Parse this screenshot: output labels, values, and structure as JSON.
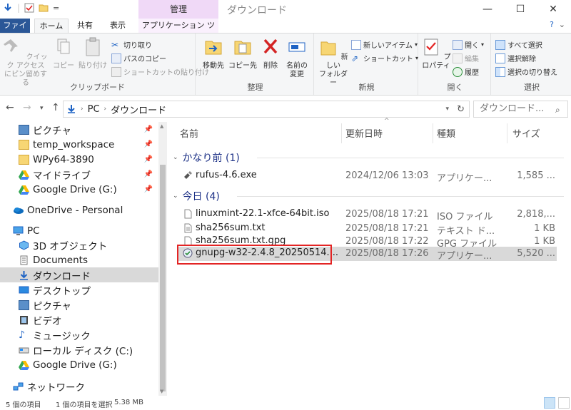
{
  "window": {
    "title": "ダウンロード",
    "manage_label": "管理",
    "qat_dropdown": "="
  },
  "ribbon_tabs": {
    "file": "ファイル",
    "home": "ホーム",
    "share": "共有",
    "view": "表示",
    "app_tools": "アプリケーション ツール"
  },
  "ribbon": {
    "clipboard": {
      "label": "クリップボード",
      "pin": "クイック アクセス\nにピン留めする",
      "copy": "コピー",
      "paste": "貼り付け",
      "cut": "切り取り",
      "copy_path": "パスのコピー",
      "paste_shortcut": "ショートカットの貼り付け"
    },
    "organize": {
      "label": "整理",
      "move_to": "移動先",
      "copy_to": "コピー先",
      "delete": "削除",
      "rename": "名前の\n変更"
    },
    "new": {
      "label": "新規",
      "new_folder": "新しい\nフォルダー",
      "new_item": "新しいアイテム",
      "shortcut": "ショートカット"
    },
    "open": {
      "label": "開く",
      "properties": "プロパティ",
      "open": "開く",
      "edit": "編集",
      "history": "履歴"
    },
    "select": {
      "label": "選択",
      "select_all": "すべて選択",
      "select_none": "選択解除",
      "invert": "選択の切り替え"
    }
  },
  "address": {
    "crumbs": [
      "PC",
      "ダウンロード"
    ],
    "search_placeholder": "ダウンロード..."
  },
  "nav": {
    "items": [
      {
        "label": "ピクチャ",
        "icon": "pictures-icon",
        "pinned": true
      },
      {
        "label": "temp_workspace",
        "icon": "folder-icon",
        "pinned": true
      },
      {
        "label": "WPy64-3890",
        "icon": "folder-icon",
        "pinned": true
      },
      {
        "label": "マイドライブ",
        "icon": "google-drive-icon",
        "pinned": true
      },
      {
        "label": "Google Drive (G:)",
        "icon": "google-drive-icon",
        "pinned": true
      },
      {
        "label": "OneDrive - Personal",
        "icon": "onedrive-icon",
        "pinned": false
      },
      {
        "label": "PC",
        "icon": "pc-icon",
        "pinned": false
      },
      {
        "label": "3D オブジェクト",
        "icon": "3d-objects-icon",
        "pinned": false
      },
      {
        "label": "Documents",
        "icon": "documents-icon",
        "pinned": false
      },
      {
        "label": "ダウンロード",
        "icon": "download-arrow-icon",
        "pinned": false
      },
      {
        "label": "デスクトップ",
        "icon": "desktop-icon",
        "pinned": false
      },
      {
        "label": "ピクチャ",
        "icon": "pictures-icon",
        "pinned": false
      },
      {
        "label": "ビデオ",
        "icon": "video-icon",
        "pinned": false
      },
      {
        "label": "ミュージック",
        "icon": "music-icon",
        "pinned": false
      },
      {
        "label": "ローカル ディスク (C:)",
        "icon": "drive-icon",
        "pinned": false
      },
      {
        "label": "Google Drive (G:)",
        "icon": "google-drive-icon",
        "pinned": false
      },
      {
        "label": "ネットワーク",
        "icon": "network-icon",
        "pinned": false
      }
    ]
  },
  "columns": {
    "name": "名前",
    "date": "更新日時",
    "type": "種類",
    "size": "サイズ"
  },
  "groups": [
    {
      "label": "かなり前 (1)",
      "files": [
        {
          "name": "rufus-4.6.exe",
          "date": "2024/12/06 13:03",
          "type": "アプリケー...",
          "size": "1,585 ..."
        }
      ]
    },
    {
      "label": "今日 (4)",
      "files": [
        {
          "name": "linuxmint-22.1-xfce-64bit.iso",
          "date": "2025/08/18 17:21",
          "type": "ISO ファイル",
          "size": "2,818,..."
        },
        {
          "name": "sha256sum.txt",
          "date": "2025/08/18 17:21",
          "type": "テキスト ド...",
          "size": "1 KB"
        },
        {
          "name": "sha256sum.txt.gpg",
          "date": "2025/08/18 17:22",
          "type": "GPG ファイル",
          "size": "1 KB"
        },
        {
          "name": "gnupg-w32-2.4.8_20250514....",
          "date": "2025/08/18 17:26",
          "type": "アプリケー...",
          "size": "5,520 ..."
        }
      ]
    }
  ],
  "status": {
    "count": "5 個の項目",
    "selected": "1 個の項目を選択",
    "size": "5.38 MB"
  },
  "colors": {
    "file_tab": "#2b5797",
    "manage_band": "#f0d9f7",
    "group_header": "#1e3287",
    "selection": "#d9d9d9",
    "highlight": "#e32424"
  }
}
